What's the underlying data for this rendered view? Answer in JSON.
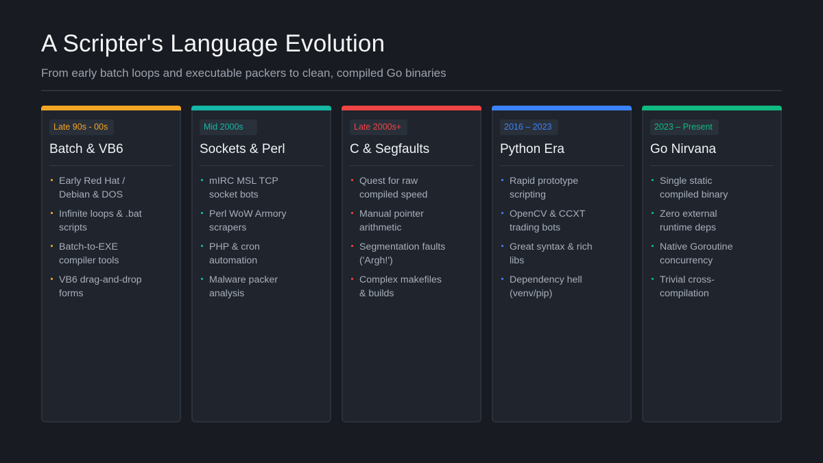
{
  "header": {
    "title": "A Scripter's Language Evolution",
    "subtitle": "From early batch loops and executable packers to clean, compiled Go binaries"
  },
  "cards": [
    {
      "era": "Late 90s - 00s",
      "title": "Batch & VB6",
      "accent": "#f5a524",
      "items": [
        "Early Red Hat / Debian & DOS",
        "Infinite loops & .bat scripts",
        "Batch-to-EXE compiler tools",
        "VB6 drag-and-drop forms"
      ]
    },
    {
      "era": "Mid 2000s",
      "title": "Sockets & Perl",
      "accent": "#14b8a6",
      "items": [
        "mIRC MSL TCP socket bots",
        "Perl WoW Armory scrapers",
        "PHP & cron automation",
        "Malware packer analysis"
      ]
    },
    {
      "era": "Late 2000s+",
      "title": "C & Segfaults",
      "accent": "#ef4444",
      "items": [
        "Quest for raw compiled speed",
        "Manual pointer arithmetic",
        "Segmentation faults ('Argh!')",
        "Complex makefiles & builds"
      ]
    },
    {
      "era": "2016 – 2023",
      "title": "Python Era",
      "accent": "#3b82f6",
      "items": [
        "Rapid prototype scripting",
        "OpenCV & CCXT trading bots",
        "Great syntax & rich libs",
        "Dependency hell (venv/pip)"
      ]
    },
    {
      "era": "2023 – Present",
      "title": "Go Nirvana",
      "accent": "#10b981",
      "items": [
        "Single static compiled binary",
        "Zero external runtime deps",
        "Native Goroutine concurrency",
        "Trivial cross-compilation"
      ]
    }
  ]
}
